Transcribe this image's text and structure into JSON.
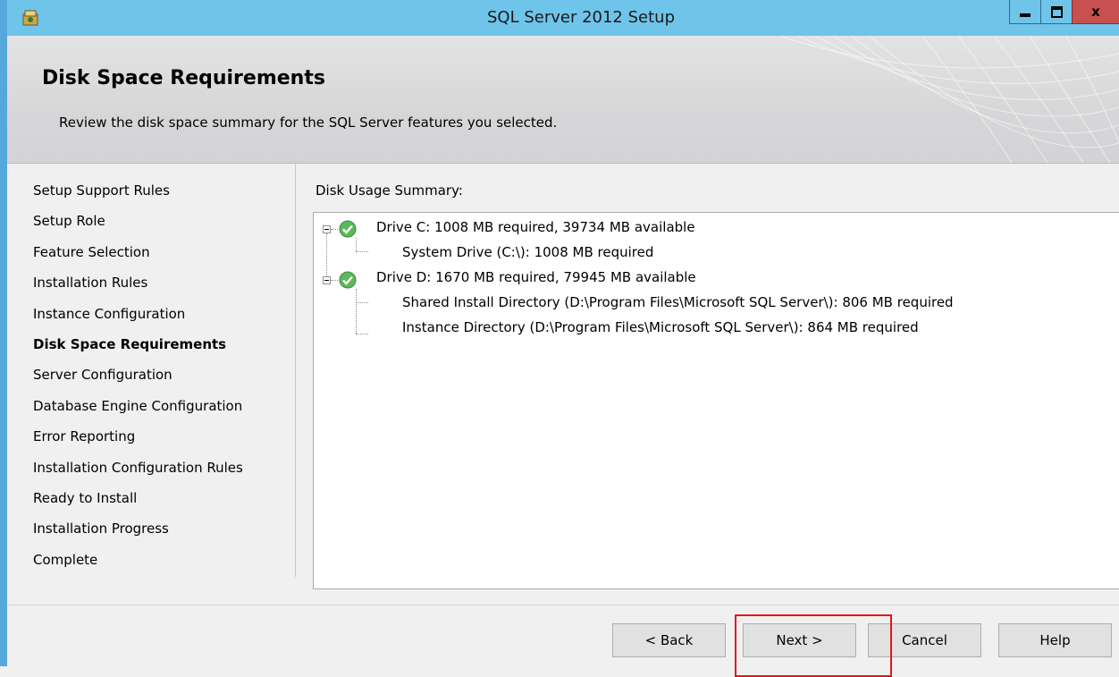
{
  "window": {
    "title": "SQL Server 2012 Setup",
    "accent_color": "#6fc4ea",
    "controls": {
      "minimize": "minimize-icon",
      "maximize": "maximize-icon",
      "close": "x"
    }
  },
  "header": {
    "title": "Disk Space Requirements",
    "subtitle": "Review the disk space summary for the SQL Server features you selected."
  },
  "nav": {
    "items": [
      {
        "label": "Setup Support Rules",
        "active": false
      },
      {
        "label": "Setup Role",
        "active": false
      },
      {
        "label": "Feature Selection",
        "active": false
      },
      {
        "label": "Installation Rules",
        "active": false
      },
      {
        "label": "Instance Configuration",
        "active": false
      },
      {
        "label": "Disk Space Requirements",
        "active": true
      },
      {
        "label": "Server Configuration",
        "active": false
      },
      {
        "label": "Database Engine Configuration",
        "active": false
      },
      {
        "label": "Error Reporting",
        "active": false
      },
      {
        "label": "Installation Configuration Rules",
        "active": false
      },
      {
        "label": "Ready to Install",
        "active": false
      },
      {
        "label": "Installation Progress",
        "active": false
      },
      {
        "label": "Complete",
        "active": false
      }
    ]
  },
  "content": {
    "label": "Disk Usage Summary:",
    "tree": [
      {
        "text": "Drive C: 1008 MB required, 39734 MB available",
        "icon": "check-icon",
        "children": [
          "System Drive (C:\\): 1008 MB required"
        ]
      },
      {
        "text": "Drive D: 1670 MB required, 79945 MB available",
        "icon": "check-icon",
        "children": [
          "Shared Install Directory (D:\\Program Files\\Microsoft SQL Server\\): 806 MB required",
          "Instance Directory (D:\\Program Files\\Microsoft SQL Server\\): 864 MB required"
        ]
      }
    ]
  },
  "footer": {
    "back_label": "< Back",
    "next_label": "Next >",
    "cancel_label": "Cancel",
    "help_label": "Help",
    "highlight_color": "#e3141e"
  }
}
